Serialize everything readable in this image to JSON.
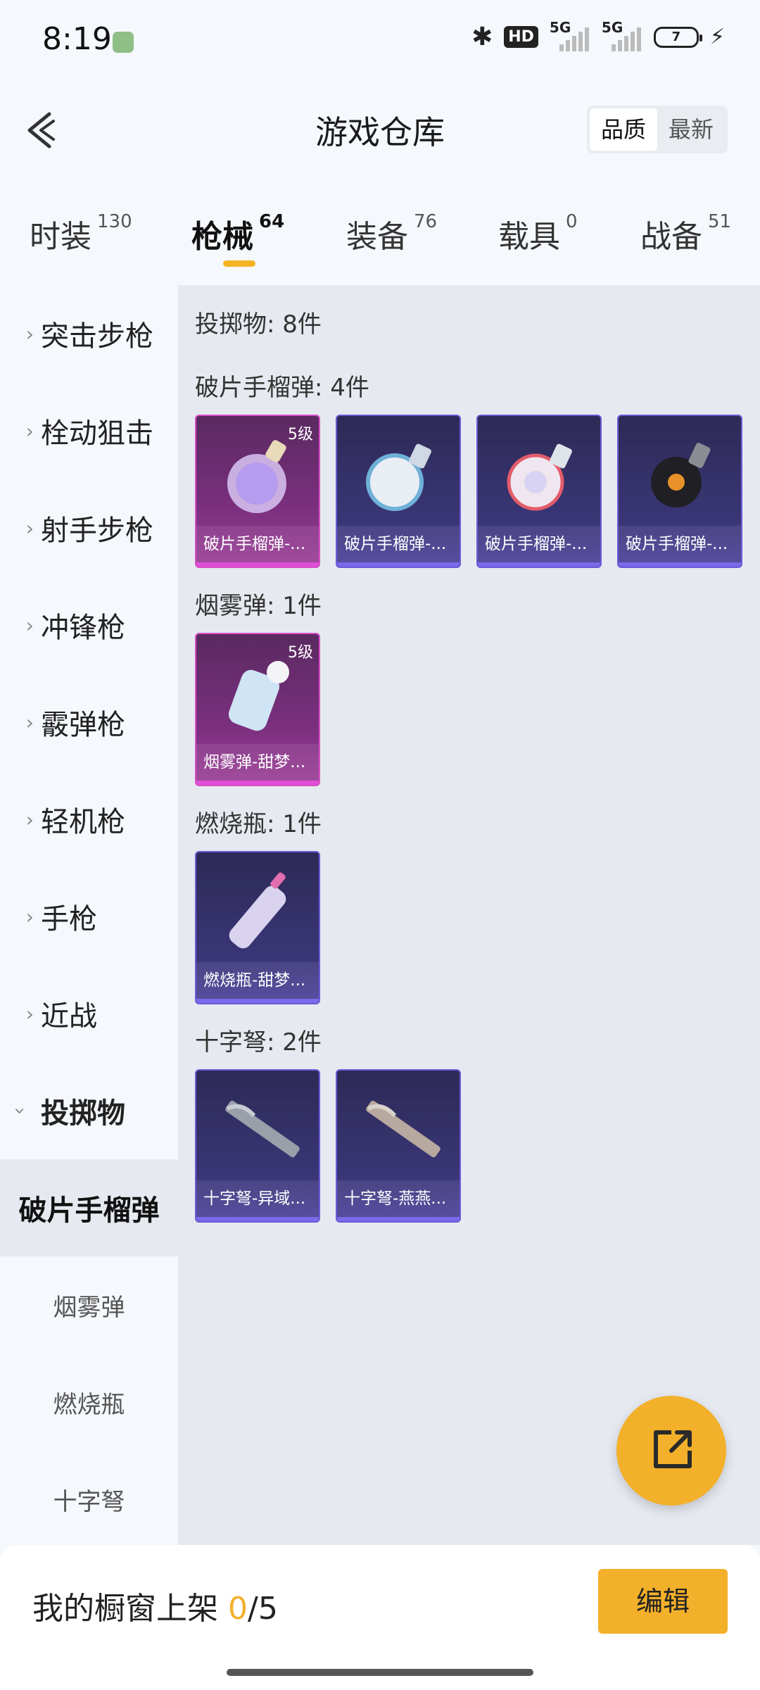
{
  "status": {
    "time": "8:19",
    "hd": "HD",
    "net1": "5G",
    "net2": "5G",
    "battery": "7"
  },
  "header": {
    "title": "游戏仓库",
    "sort_quality": "品质",
    "sort_latest": "最新"
  },
  "tabs": [
    {
      "label": "时装",
      "count": "130"
    },
    {
      "label": "枪械",
      "count": "64"
    },
    {
      "label": "装备",
      "count": "76"
    },
    {
      "label": "载具",
      "count": "0"
    },
    {
      "label": "战备",
      "count": "51"
    }
  ],
  "sidebar": {
    "items": [
      {
        "label": "突击步枪"
      },
      {
        "label": "栓动狙击"
      },
      {
        "label": "射手步枪"
      },
      {
        "label": "冲锋枪"
      },
      {
        "label": "霰弹枪"
      },
      {
        "label": "轻机枪"
      },
      {
        "label": "手枪"
      },
      {
        "label": "近战"
      },
      {
        "label": "投掷物"
      }
    ],
    "subitems": [
      {
        "label": "破片手榴弹"
      },
      {
        "label": "烟雾弹"
      },
      {
        "label": "燃烧瓶"
      },
      {
        "label": "十字弩"
      }
    ]
  },
  "content": {
    "total": "投掷物: 8件",
    "groups": [
      {
        "title": "破片手榴弹: 4件",
        "items": [
          {
            "name": "破片手榴弹-...",
            "level": "5级",
            "icon": "potion-bottle-icon"
          },
          {
            "name": "破片手榴弹-...",
            "icon": "grenade-icon"
          },
          {
            "name": "破片手榴弹-...",
            "icon": "grenade-icon"
          },
          {
            "name": "破片手榴弹-...",
            "icon": "grenade-icon"
          }
        ]
      },
      {
        "title": "烟雾弹: 1件",
        "items": [
          {
            "name": "烟雾弹-甜梦...",
            "level": "5级",
            "icon": "smoke-bottle-icon"
          }
        ]
      },
      {
        "title": "燃烧瓶: 1件",
        "items": [
          {
            "name": "燃烧瓶-甜梦...",
            "icon": "molotov-bottle-icon"
          }
        ]
      },
      {
        "title": "十字弩: 2件",
        "items": [
          {
            "name": "十字弩-异域...",
            "icon": "crossbow-icon"
          },
          {
            "name": "十字弩-燕燕...",
            "icon": "crossbow-icon"
          }
        ]
      }
    ]
  },
  "bottom": {
    "showcase_label": "我的橱窗上架 ",
    "showcase_current": "0",
    "showcase_total": "/5",
    "edit": "编辑"
  },
  "colors": {
    "accent": "#f3b02a",
    "card_blue_border": "#6b5bd6",
    "card_purple_border": "#d74fc8"
  }
}
